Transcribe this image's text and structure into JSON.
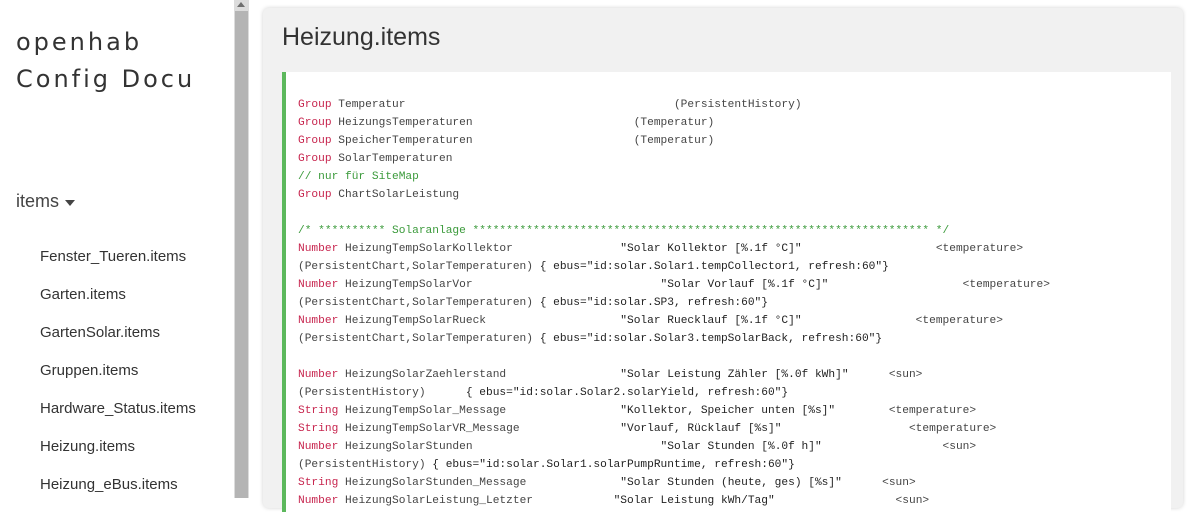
{
  "brand": {
    "line1": "openhab",
    "line2": "Config Docu"
  },
  "sidebar": {
    "section_label": "items",
    "items": [
      "Fenster_Tueren.items",
      "Garten.items",
      "GartenSolar.items",
      "Gruppen.items",
      "Hardware_Status.items",
      "Heizung.items",
      "Heizung_eBus.items"
    ]
  },
  "page": {
    "title": "Heizung.items"
  },
  "code": {
    "lines": [
      [
        {
          "t": "kw",
          "v": "Group"
        },
        {
          "t": "id",
          "v": " Temperatur                                        (PersistentHistory)"
        }
      ],
      [
        {
          "t": "kw",
          "v": "Group"
        },
        {
          "t": "id",
          "v": " HeizungsTemperaturen                        (Temperatur)"
        }
      ],
      [
        {
          "t": "kw",
          "v": "Group"
        },
        {
          "t": "id",
          "v": " SpeicherTemperaturen                        (Temperatur)"
        }
      ],
      [
        {
          "t": "kw",
          "v": "Group"
        },
        {
          "t": "id",
          "v": " SolarTemperaturen"
        }
      ],
      [
        {
          "t": "cm",
          "v": "// nur für SiteMap"
        }
      ],
      [
        {
          "t": "kw",
          "v": "Group"
        },
        {
          "t": "id",
          "v": " ChartSolarLeistung"
        }
      ],
      [],
      [
        {
          "t": "cm",
          "v": "/* ********** Solaranlage ******************************************************************** */"
        }
      ],
      [
        {
          "t": "kw",
          "v": "Number"
        },
        {
          "t": "id",
          "v": " HeizungTempSolarKollektor"
        },
        {
          "t": "str",
          "v": "                \"Solar Kollektor [%.1f °C]\"                    "
        },
        {
          "t": "id",
          "v": "<temperature>"
        }
      ],
      [
        {
          "t": "id",
          "v": "(PersistentChart,SolarTemperaturen)"
        },
        {
          "t": "str",
          "v": " { ebus=\"id:solar.Solar1.tempCollector1, refresh:60\"}"
        }
      ],
      [
        {
          "t": "kw",
          "v": "Number"
        },
        {
          "t": "id",
          "v": " HeizungTempSolarVor"
        },
        {
          "t": "str",
          "v": "                            \"Solar Vorlauf [%.1f °C]\"                    "
        },
        {
          "t": "id",
          "v": "<temperature>"
        }
      ],
      [
        {
          "t": "id",
          "v": "(PersistentChart,SolarTemperaturen)"
        },
        {
          "t": "str",
          "v": " { ebus=\"id:solar.SP3, refresh:60\"}"
        }
      ],
      [
        {
          "t": "kw",
          "v": "Number"
        },
        {
          "t": "id",
          "v": " HeizungTempSolarRueck"
        },
        {
          "t": "str",
          "v": "                    \"Solar Ruecklauf [%.1f °C]\"                 "
        },
        {
          "t": "id",
          "v": "<temperature>"
        }
      ],
      [
        {
          "t": "id",
          "v": "(PersistentChart,SolarTemperaturen)"
        },
        {
          "t": "str",
          "v": " { ebus=\"id:solar.Solar3.tempSolarBack, refresh:60\"}"
        }
      ],
      [],
      [
        {
          "t": "kw",
          "v": "Number"
        },
        {
          "t": "id",
          "v": " HeizungSolarZaehlerstand"
        },
        {
          "t": "str",
          "v": "                 \"Solar Leistung Zähler [%.0f kWh]\"      "
        },
        {
          "t": "id",
          "v": "<sun>"
        }
      ],
      [
        {
          "t": "id",
          "v": "(PersistentHistory)"
        },
        {
          "t": "str",
          "v": "      { ebus=\"id:solar.Solar2.solarYield, refresh:60\"}"
        }
      ],
      [
        {
          "t": "kw",
          "v": "String"
        },
        {
          "t": "id",
          "v": " HeizungTempSolar_Message"
        },
        {
          "t": "str",
          "v": "                 \"Kollektor, Speicher unten [%s]\"        "
        },
        {
          "t": "id",
          "v": "<temperature>"
        }
      ],
      [
        {
          "t": "kw",
          "v": "String"
        },
        {
          "t": "id",
          "v": " HeizungTempSolarVR_Message"
        },
        {
          "t": "str",
          "v": "               \"Vorlauf, Rücklauf [%s]\"                   "
        },
        {
          "t": "id",
          "v": "<temperature>"
        }
      ],
      [
        {
          "t": "kw",
          "v": "Number"
        },
        {
          "t": "id",
          "v": " HeizungSolarStunden"
        },
        {
          "t": "str",
          "v": "                            \"Solar Stunden [%.0f h]\"                  "
        },
        {
          "t": "id",
          "v": "<sun>"
        }
      ],
      [
        {
          "t": "id",
          "v": "(PersistentHistory)"
        },
        {
          "t": "str",
          "v": " { ebus=\"id:solar.Solar1.solarPumpRuntime, refresh:60\"}"
        }
      ],
      [
        {
          "t": "kw",
          "v": "String"
        },
        {
          "t": "id",
          "v": " HeizungSolarStunden_Message"
        },
        {
          "t": "str",
          "v": "              \"Solar Stunden (heute, ges) [%s]\"      "
        },
        {
          "t": "id",
          "v": "<sun>"
        }
      ],
      [
        {
          "t": "kw",
          "v": "Number"
        },
        {
          "t": "id",
          "v": " HeizungSolarLeistung_Letzter"
        },
        {
          "t": "str",
          "v": "            \"Solar Leistung kWh/Tag\"                  "
        },
        {
          "t": "id",
          "v": "<sun>"
        }
      ]
    ]
  }
}
